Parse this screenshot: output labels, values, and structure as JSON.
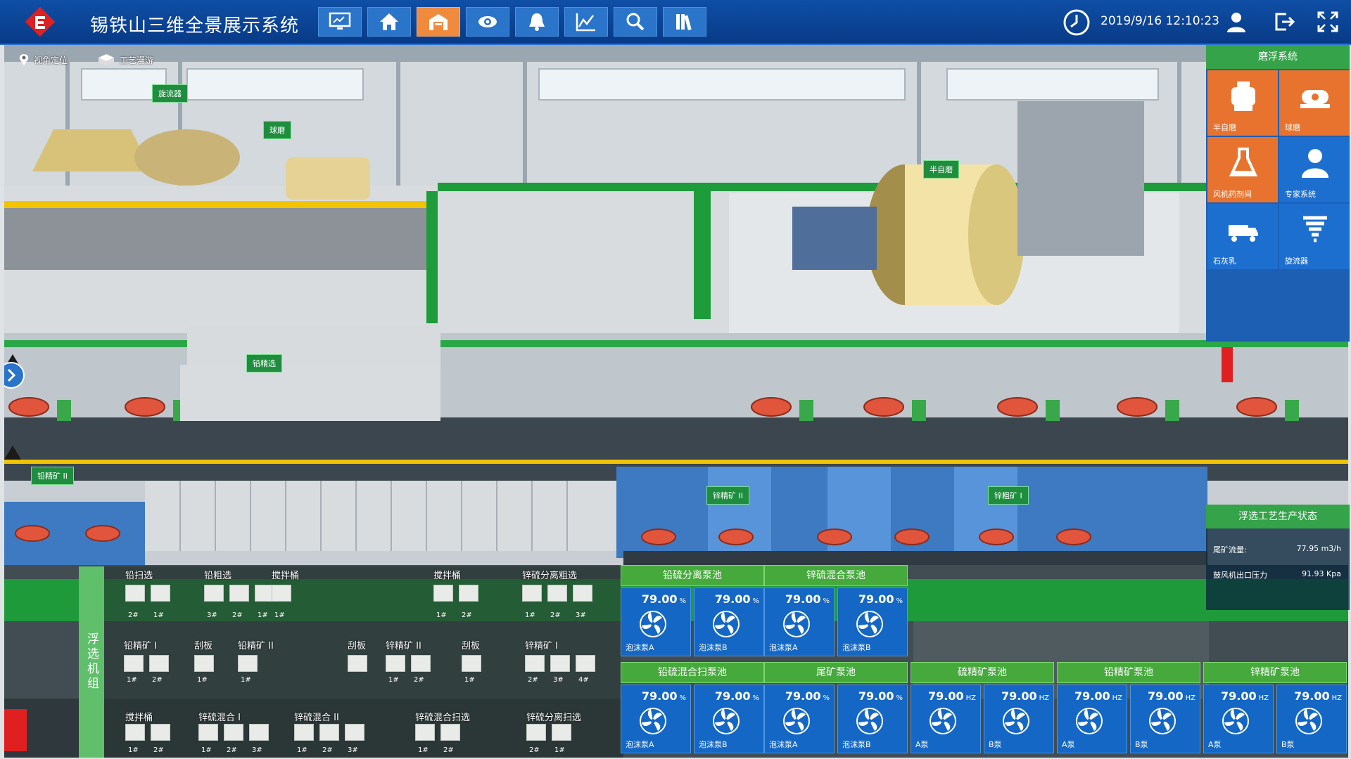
{
  "header": {
    "title": "锡铁山三维全景展示系统",
    "datetime": "2019/9/16 12:10:23",
    "nav": [
      {
        "icon": "monitor-icon"
      },
      {
        "icon": "home-icon"
      },
      {
        "icon": "factory-icon",
        "active": true
      },
      {
        "icon": "eye-icon"
      },
      {
        "icon": "bell-icon"
      },
      {
        "icon": "line-chart-icon"
      },
      {
        "icon": "search-icon"
      },
      {
        "icon": "books-icon"
      }
    ]
  },
  "toolbar": {
    "view_locate": "视角定位",
    "process_tour": "工艺漫游"
  },
  "scene_tags": [
    "旋流器",
    "球磨",
    "半自磨",
    "铅精选",
    "铅精矿 II",
    "锌精矿 II",
    "锌粗矿 I"
  ],
  "mill_panel": {
    "title": "磨浮系统",
    "tiles": [
      {
        "label": "半自磨",
        "color": "#e8732e",
        "icon": "semi-mill-icon"
      },
      {
        "label": "球磨",
        "color": "#e8732e",
        "icon": "ball-mill-icon"
      },
      {
        "label": "风机药剂间",
        "color": "#e8732e",
        "icon": "flask-icon"
      },
      {
        "label": "专家系统",
        "color": "#1d6fcf",
        "icon": "expert-icon"
      },
      {
        "label": "石灰乳",
        "color": "#1d6fcf",
        "icon": "lime-truck-icon"
      },
      {
        "label": "旋流器",
        "color": "#1d6fcf",
        "icon": "cyclone-icon"
      }
    ]
  },
  "flotation_status": {
    "title": "浮选工艺生产状态",
    "rows": [
      {
        "label": "尾矿流量:",
        "value": "77.95 m3/h"
      },
      {
        "label": "鼓风机出口压力",
        "value": "91.93 Kpa"
      }
    ]
  },
  "unit": {
    "side_label": "浮选机组",
    "row1": [
      {
        "label": "铅扫选",
        "nums": [
          "2#",
          "1#"
        ]
      },
      {
        "label": "铅粗选",
        "nums": [
          "3#",
          "2#",
          "1#"
        ]
      },
      {
        "label": "搅拌桶",
        "nums": [
          "1#"
        ]
      },
      {
        "label": "搅拌桶",
        "nums": [
          "1#",
          "2#"
        ]
      },
      {
        "label": "锌硫分离粗选",
        "nums": [
          "1#",
          "2#",
          "3#"
        ]
      }
    ],
    "row2": [
      {
        "label": "铅精矿 I",
        "nums": [
          "1#",
          "2#"
        ]
      },
      {
        "label": "刮板",
        "nums": [
          "1#"
        ]
      },
      {
        "label": "铅精矿 II",
        "nums": [
          "1#"
        ]
      },
      {
        "label": "刮板",
        "nums": []
      },
      {
        "label": "锌精矿 II",
        "nums": [
          "1#",
          "2#"
        ]
      },
      {
        "label": "刮板",
        "nums": [
          "1#"
        ]
      },
      {
        "label": "锌精矿 I",
        "nums": [
          "2#",
          "3#",
          "4#"
        ]
      }
    ],
    "row3": [
      {
        "label": "搅拌桶",
        "nums": [
          "1#",
          "2#"
        ]
      },
      {
        "label": "锌硫混合 I",
        "nums": [
          "1#",
          "2#",
          "3#"
        ]
      },
      {
        "label": "锌硫混合 II",
        "nums": [
          "1#",
          "2#",
          "3#"
        ]
      },
      {
        "label": "锌硫混合扫选",
        "nums": [
          "1#",
          "2#"
        ]
      },
      {
        "label": "锌硫分离扫选",
        "nums": [
          "2#",
          "1#"
        ]
      }
    ]
  },
  "pump_groups": [
    {
      "title": "铅硫分离泵池",
      "cells": [
        {
          "value": "79.00",
          "unit": "%",
          "name": "泡沫泵A"
        },
        {
          "value": "79.00",
          "unit": "%",
          "name": "泡沫泵B"
        }
      ]
    },
    {
      "title": "锌硫混合泵池",
      "cells": [
        {
          "value": "79.00",
          "unit": "%",
          "name": "泡沫泵A"
        },
        {
          "value": "79.00",
          "unit": "%",
          "name": "泡沫泵B"
        }
      ]
    },
    {
      "title": "铅硫混合扫泵池",
      "cells": [
        {
          "value": "79.00",
          "unit": "%",
          "name": "泡沫泵A"
        },
        {
          "value": "79.00",
          "unit": "%",
          "name": "泡沫泵B"
        }
      ]
    },
    {
      "title": "尾矿泵池",
      "cells": [
        {
          "value": "79.00",
          "unit": "%",
          "name": "泡沫泵A"
        },
        {
          "value": "79.00",
          "unit": "%",
          "name": "泡沫泵B"
        }
      ]
    },
    {
      "title": "硫精矿泵池",
      "cells": [
        {
          "value": "79.00",
          "unit": "HZ",
          "name": "A泵"
        },
        {
          "value": "79.00",
          "unit": "HZ",
          "name": "B泵"
        }
      ]
    },
    {
      "title": "铅精矿泵池",
      "cells": [
        {
          "value": "79.00",
          "unit": "HZ",
          "name": "A泵"
        },
        {
          "value": "79.00",
          "unit": "HZ",
          "name": "B泵"
        }
      ]
    },
    {
      "title": "锌精矿泵池",
      "cells": [
        {
          "value": "79.00",
          "unit": "HZ",
          "name": "A泵"
        },
        {
          "value": "79.00",
          "unit": "HZ",
          "name": "B泵"
        }
      ]
    }
  ],
  "colors": {
    "nav_active": "#f08a3c",
    "panel_green": "#46a93c",
    "pump_blue": "#1467c4",
    "brand_red": "#e02020"
  }
}
